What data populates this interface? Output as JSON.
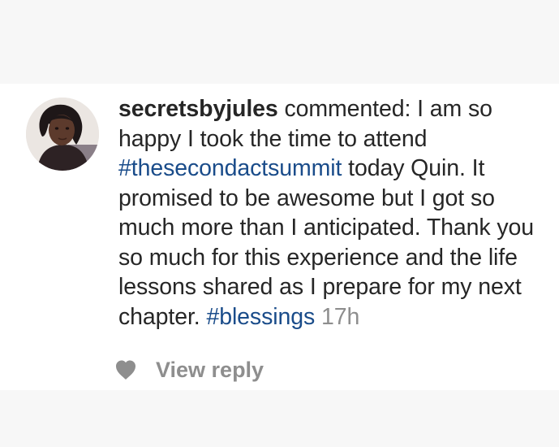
{
  "comment": {
    "username": "secretsbyjules",
    "verb": " commented: ",
    "text_1": "I am so happy I took the time to attend ",
    "hashtag_1": "#thesecondactsummit",
    "text_2": " today Quin. It promised to be awesome but I got so much more than I anticipated. Thank you so much for this experience and the life lessons shared as I prepare for my next chapter. ",
    "hashtag_2": "#blessings",
    "timestamp": "17h"
  },
  "actions": {
    "like_icon": "heart-icon",
    "view_reply_label": "View reply"
  },
  "colors": {
    "hashtag": "#1a4c8a",
    "text": "#262626",
    "muted": "#8e8e8e",
    "card_background": "#ffffff",
    "page_background": "#f7f7f7"
  }
}
